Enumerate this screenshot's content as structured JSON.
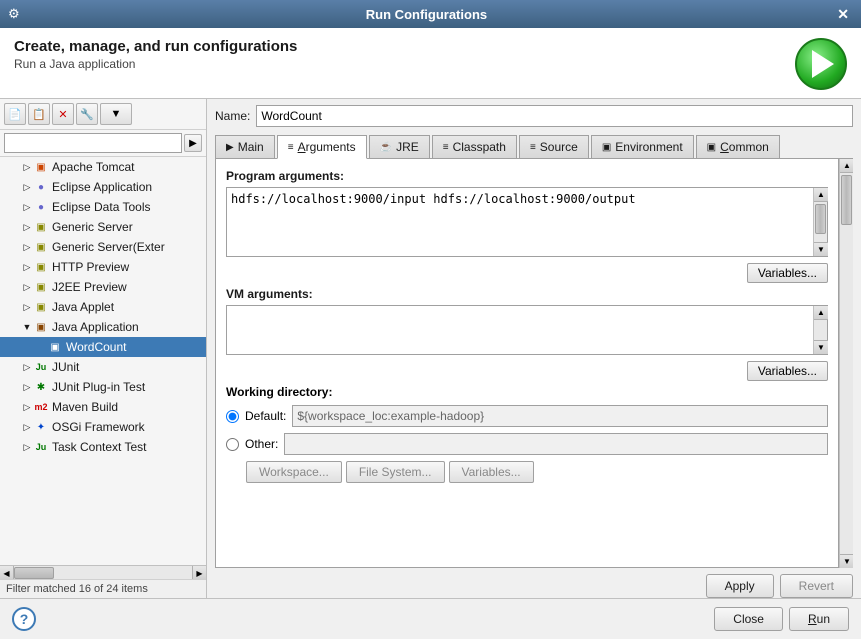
{
  "titleBar": {
    "icon": "⚙",
    "title": "Run Configurations",
    "closeBtn": "✕"
  },
  "header": {
    "title": "Create, manage, and run configurations",
    "subtitle": "Run a Java application"
  },
  "toolbar": {
    "newBtn": "📄",
    "dupBtn": "📋",
    "delBtn": "✕",
    "filterBtn": "🔧",
    "dropBtn": "▼"
  },
  "search": {
    "placeholder": "",
    "clearBtn": "▶"
  },
  "tree": {
    "items": [
      {
        "id": "apache-tomcat",
        "label": "Apache Tomcat",
        "indent": "child",
        "icon": "▣",
        "iconClass": "icon-tomcat"
      },
      {
        "id": "eclipse-app",
        "label": "Eclipse Application",
        "indent": "child",
        "icon": "●",
        "iconClass": "icon-eclipse"
      },
      {
        "id": "eclipse-data",
        "label": "Eclipse Data Tools",
        "indent": "child",
        "icon": "●",
        "iconClass": "icon-data"
      },
      {
        "id": "generic-server",
        "label": "Generic Server",
        "indent": "child",
        "icon": "▣",
        "iconClass": "icon-generic"
      },
      {
        "id": "generic-server-ext",
        "label": "Generic Server(Exter",
        "indent": "child",
        "icon": "▣",
        "iconClass": "icon-generic"
      },
      {
        "id": "http-preview",
        "label": "HTTP Preview",
        "indent": "child",
        "icon": "▣",
        "iconClass": "icon-http"
      },
      {
        "id": "j2ee-preview",
        "label": "J2EE Preview",
        "indent": "child",
        "icon": "▣",
        "iconClass": "icon-j2ee"
      },
      {
        "id": "java-applet",
        "label": "Java Applet",
        "indent": "child",
        "icon": "▣",
        "iconClass": "icon-applet"
      },
      {
        "id": "java-application",
        "label": "Java Application",
        "indent": "child",
        "icon": "▣",
        "iconClass": "icon-java",
        "expanded": true,
        "expandArrow": "▼"
      },
      {
        "id": "wordcount",
        "label": "WordCount",
        "indent": "child2",
        "icon": "▣",
        "iconClass": "icon-java",
        "selected": true
      },
      {
        "id": "junit",
        "label": "JUnit",
        "indent": "child",
        "icon": "Ju",
        "iconClass": "icon-junit"
      },
      {
        "id": "junit-plugin",
        "label": "JUnit Plug-in Test",
        "indent": "child",
        "icon": "✱",
        "iconClass": "icon-junit"
      },
      {
        "id": "maven-build",
        "label": "Maven Build",
        "indent": "child",
        "icon": "m2",
        "iconClass": "icon-maven"
      },
      {
        "id": "osgi",
        "label": "OSGi Framework",
        "indent": "child",
        "icon": "✦",
        "iconClass": "icon-osgi"
      },
      {
        "id": "task-context",
        "label": "Task Context Test",
        "indent": "child",
        "icon": "Ju",
        "iconClass": "icon-task"
      }
    ],
    "filterStatus": "Filter matched 16 of 24 items"
  },
  "nameField": {
    "label": "Name:",
    "value": "WordCount"
  },
  "tabs": [
    {
      "id": "main",
      "label": "Main",
      "icon": "▶",
      "active": false
    },
    {
      "id": "arguments",
      "label": "Arguments",
      "icon": "≡",
      "active": true
    },
    {
      "id": "jre",
      "label": "JRE",
      "icon": "☕",
      "active": false
    },
    {
      "id": "classpath",
      "label": "Classpath",
      "icon": "≡",
      "active": false
    },
    {
      "id": "source",
      "label": "Source",
      "icon": "≡",
      "active": false
    },
    {
      "id": "environment",
      "label": "Environment",
      "icon": "▣",
      "active": false
    },
    {
      "id": "common",
      "label": "Common",
      "icon": "▣",
      "active": false
    }
  ],
  "arguments": {
    "programArgsLabel": "Program arguments:",
    "programArgsValue": "hdfs://localhost:9000/input hdfs://localhost:9000/output",
    "programArgsVarsBtn": "Variables...",
    "vmArgsLabel": "VM arguments:",
    "vmArgsValue": "",
    "vmArgsVarsBtn": "Variables...",
    "workingDirLabel": "Working directory:",
    "defaultRadioLabel": "Default:",
    "defaultValue": "${workspace_loc:example-hadoop}",
    "otherRadioLabel": "Other:",
    "otherValue": "",
    "workspaceBtn": "Workspace...",
    "fileSystemBtn": "File System...",
    "variablesBtn": "Variables..."
  },
  "footer": {
    "helpBtn": "?",
    "applyBtn": "Apply",
    "revertBtn": "Revert",
    "closeBtn": "Close",
    "runBtn": "Run"
  }
}
